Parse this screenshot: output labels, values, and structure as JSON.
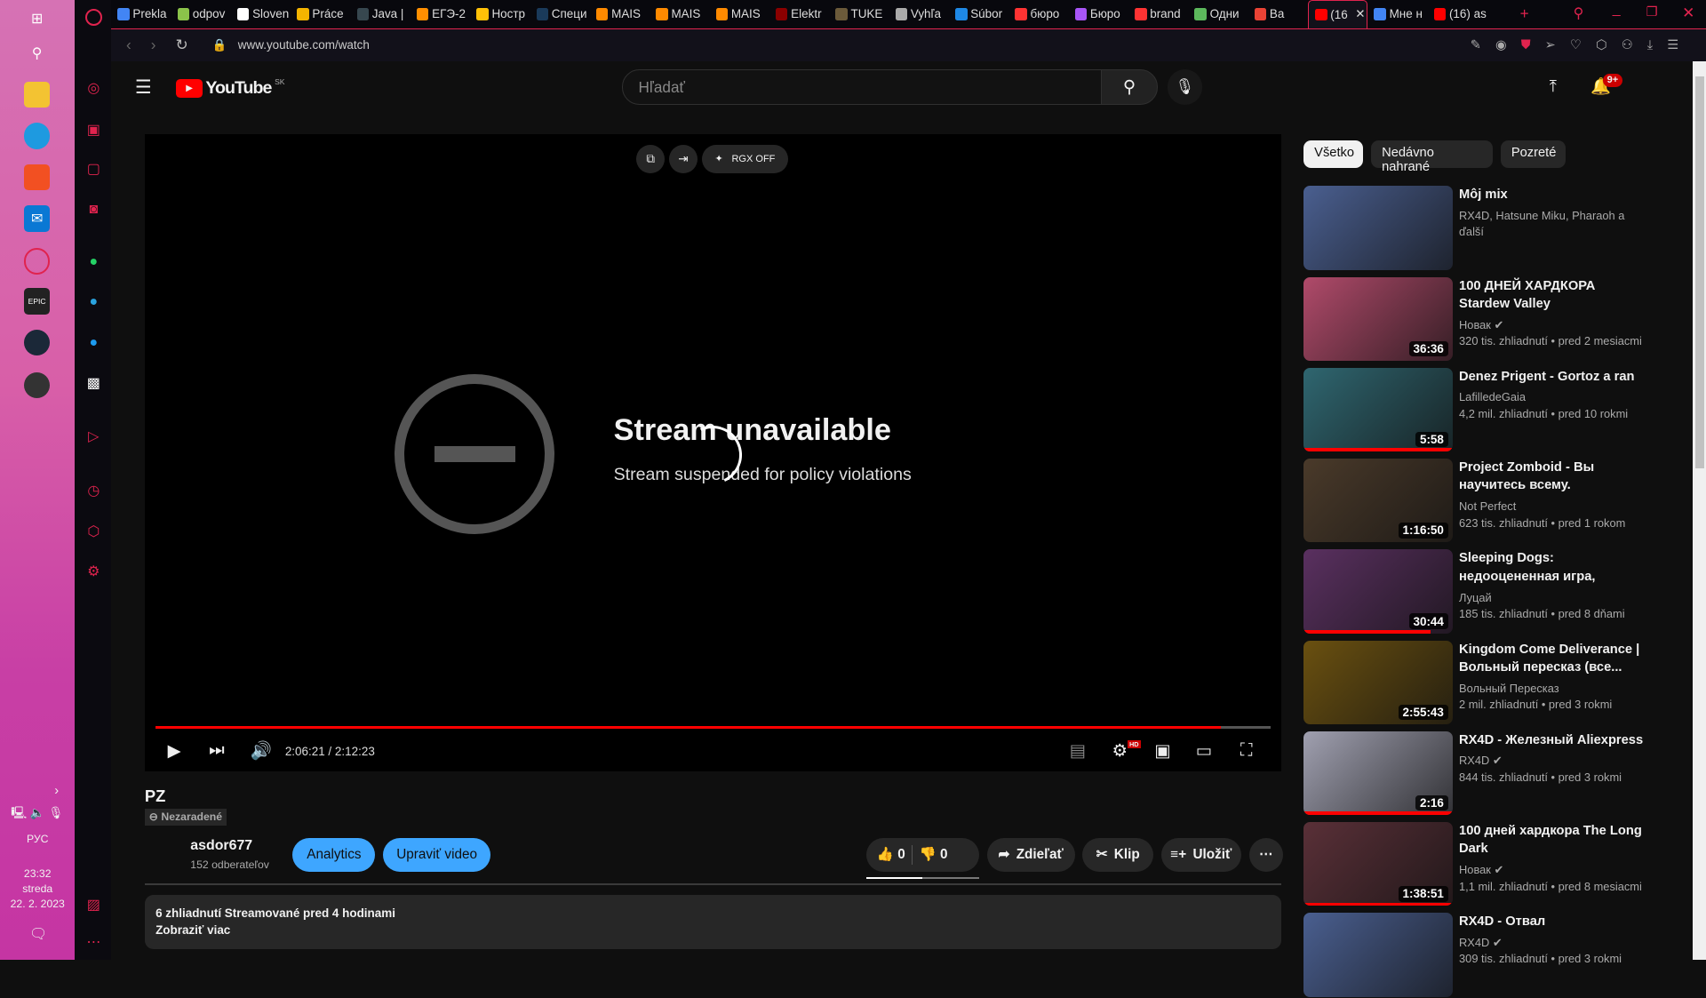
{
  "taskbar": {
    "lang": "РУС",
    "time": "23:32",
    "day": "streda",
    "date": "22. 2. 2023"
  },
  "browser": {
    "tabs": [
      {
        "label": "Prekla",
        "color": "#4285f4"
      },
      {
        "label": "odpov",
        "color": "#8bc34a"
      },
      {
        "label": "Sloven",
        "color": "#ffffff"
      },
      {
        "label": "Práce",
        "color": "#f4b400"
      },
      {
        "label": "Java |",
        "color": "#37474f"
      },
      {
        "label": "ЕГЭ-2",
        "color": "#ff8f00"
      },
      {
        "label": "Ностр",
        "color": "#ffc107"
      },
      {
        "label": "Специ",
        "color": "#1a3a5a"
      },
      {
        "label": "MAIS",
        "color": "#ff8a00"
      },
      {
        "label": "MAIS",
        "color": "#ff8a00"
      },
      {
        "label": "MAIS",
        "color": "#ff8a00"
      },
      {
        "label": "Elektr",
        "color": "#8b0000"
      },
      {
        "label": "TUKE",
        "color": "#6b5a3a"
      },
      {
        "label": "Vyhľa",
        "color": "#aaaaaa"
      },
      {
        "label": "Súbor",
        "color": "#1e88e5"
      },
      {
        "label": "бюро",
        "color": "#f33"
      },
      {
        "label": "Бюро",
        "color": "#a855f7"
      },
      {
        "label": "brand",
        "color": "#f33"
      },
      {
        "label": "Одни",
        "color": "#5cb85c"
      },
      {
        "label": "Ba",
        "color": "#ea4335"
      },
      {
        "label": "(16",
        "color": "#ff0000",
        "active": true
      },
      {
        "label": "Мне н",
        "color": "#4285f4"
      },
      {
        "label": "(16) as",
        "color": "#ff0000"
      }
    ],
    "url": "www.youtube.com/watch"
  },
  "youtube": {
    "country": "SK",
    "logo": "YouTube",
    "search_placeholder": "Hľadať",
    "notifications": "9+",
    "player": {
      "error_title": "Stream unavailable",
      "error_sub": "Stream suspended for policy violations",
      "rgx": "RGX OFF",
      "time": "2:06:21 / 2:12:23",
      "progress": 0.955,
      "hd": "HD"
    },
    "video": {
      "title": "PZ",
      "visibility": "Nezaradené",
      "channel": "asdor677",
      "subs": "152 odberateľov",
      "analytics": "Analytics",
      "edit": "Upraviť video",
      "likes": "0",
      "dislikes": "0",
      "share": "Zdieľať",
      "clip": "Klip",
      "save": "Uložiť",
      "desc_meta": "6 zhliadnutí  Streamované pred 4 hodinami",
      "show_more": "Zobraziť viac"
    },
    "chips": [
      "Všetko",
      "Nedávno nahrané",
      "Pozreté"
    ],
    "recs": [
      {
        "title": "Môj mix",
        "channel": "RX4D, Hatsune Miku, Pharaoh a ďalší",
        "meta": "",
        "duration": "",
        "color": "#4a5f90",
        "progress": 0
      },
      {
        "title": "100 ДНЕЙ ХАРДКОРА Stardew Valley",
        "channel": "Новак",
        "verified": true,
        "meta": "320 tis. zhliadnutí  • pred 2 mesiacmi",
        "duration": "36:36",
        "color": "#b04a6a",
        "progress": 0
      },
      {
        "title": "Denez Prigent - Gortoz a ran",
        "channel": "LafilledeGaia",
        "meta": "4,2 mil. zhliadnutí  • pred 10 rokmi",
        "duration": "5:58",
        "color": "#2f6670",
        "progress": 1
      },
      {
        "title": "Project Zomboid - Вы научитесь всему.",
        "channel": "Not Perfect",
        "meta": "623 tis. zhliadnutí  • pred 1 rokom",
        "duration": "1:16:50",
        "color": "#4a3a2a",
        "progress": 0
      },
      {
        "title": "Sleeping Dogs: недооцененная игра, которая круче GTA даж...",
        "channel": "Луцай",
        "meta": "185 tis. zhliadnutí  • pred 8 dňami",
        "duration": "30:44",
        "color": "#5a3060",
        "progress": 0.85
      },
      {
        "title": "Kingdom Come Deliverance | Вольный пересказ (все...",
        "channel": "Вольный Пересказ",
        "meta": "2 mil. zhliadnutí  • pred 3 rokmi",
        "duration": "2:55:43",
        "color": "#6a5010",
        "progress": 0
      },
      {
        "title": "RX4D - Железный Aliexpress",
        "channel": "RX4D",
        "verified": true,
        "meta": "844 tis. zhliadnutí  • pred 3 rokmi",
        "duration": "2:16",
        "color": "#a0a0b0",
        "progress": 1
      },
      {
        "title": "100 дней хардкора The Long Dark",
        "channel": "Новак",
        "verified": true,
        "meta": "1,1 mil. zhliadnutí  • pred 8 mesiacmi",
        "duration": "1:38:51",
        "color": "#5a3038",
        "progress": 1
      },
      {
        "title": "RX4D - Отвал",
        "channel": "RX4D",
        "verified": true,
        "meta": "309 tis. zhliadnutí  • pred 3 rokmi",
        "duration": "",
        "color": "#4a5f90",
        "progress": 0
      }
    ]
  }
}
